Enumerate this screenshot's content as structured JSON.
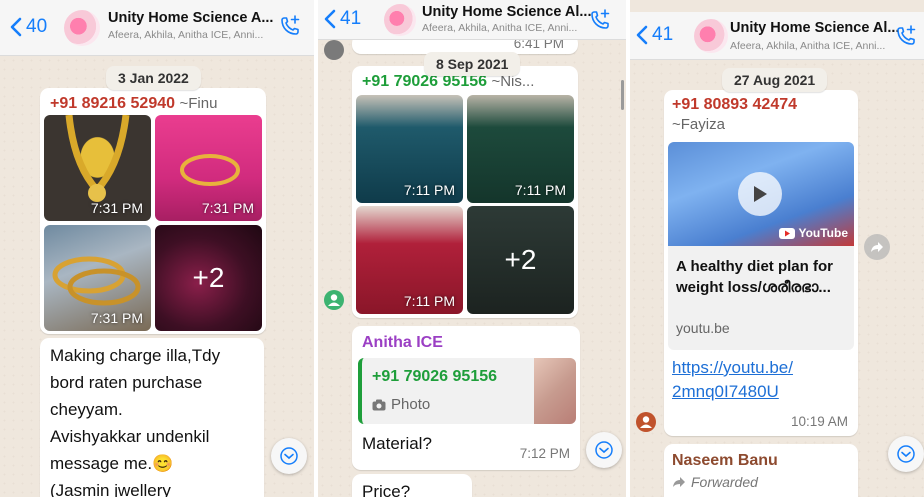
{
  "colors": {
    "ios_blue": "#157efb",
    "sender_red": "#c0392b",
    "sender_green": "#1e9e3a",
    "sender_purple": "#9b3fc4",
    "sender_brown": "#8d4a2f",
    "link_blue": "#1d6fd6"
  },
  "panels": [
    {
      "header": {
        "back_count": "40",
        "title": "Unity Home Science A...",
        "subtitle": "Afeera, Akhila, Anitha ICE, Anni..."
      },
      "date_pill": "3 Jan 2022",
      "media_message": {
        "sender": "+91 89216 52940",
        "sender_alias": "~Finu",
        "tiles": [
          {
            "time": "7:31 PM",
            "subject": "gold-necklace"
          },
          {
            "time": "7:31 PM",
            "subject": "gold-bangle-pink"
          },
          {
            "time": "7:31 PM",
            "subject": "gold-bangles"
          },
          {
            "overflow": "+2"
          }
        ]
      },
      "text_message": {
        "lines": [
          "Making charge illa,Tdy",
          "bord raten purchase",
          "cheyyam.",
          "Avishyakkar undenkil",
          "message me.😊",
          "(Jasmin jwellery"
        ]
      }
    },
    {
      "header": {
        "back_count": "41",
        "title": "Unity Home Science Al...",
        "subtitle": "Afeera, Akhila, Anitha ICE, Anni..."
      },
      "prev_time": "6:41 PM",
      "date_pill": "8 Sep 2021",
      "media_message": {
        "sender": "+91 79026 95156",
        "sender_alias": "~Nis...",
        "tiles": [
          {
            "time": "7:11 PM",
            "subject": "teal-kurta"
          },
          {
            "time": "7:11 PM",
            "subject": "green-kurta"
          },
          {
            "time": "7:11 PM",
            "subject": "red-kurta"
          },
          {
            "overflow": "+2"
          }
        ]
      },
      "reply_message": {
        "sender": "Anitha ICE",
        "quoted_sender": "+91 79026 95156",
        "quoted_type": "Photo",
        "text": "Material?",
        "time": "7:12 PM"
      },
      "next_message": {
        "text": "Price?"
      }
    },
    {
      "header": {
        "back_count": "41",
        "title": "Unity Home Science Al...",
        "subtitle": "Afeera, Akhila, Anitha ICE, Anni..."
      },
      "date_pill": "27 Aug 2021",
      "link_message": {
        "sender": "+91 80893 42474",
        "sender_alias": "~Fayiza",
        "youtube_label": "YouTube",
        "preview_title_line1": "A healthy diet plan for",
        "preview_title_line2": "weight loss/ശരീരഭാ...",
        "domain": "youtu.be",
        "link_line1": "https://youtu.be/",
        "link_line2": "2mnq0I7480U",
        "time": "10:19 AM"
      },
      "next_message": {
        "sender": "Naseem Banu",
        "forwarded": "Forwarded"
      }
    }
  ]
}
